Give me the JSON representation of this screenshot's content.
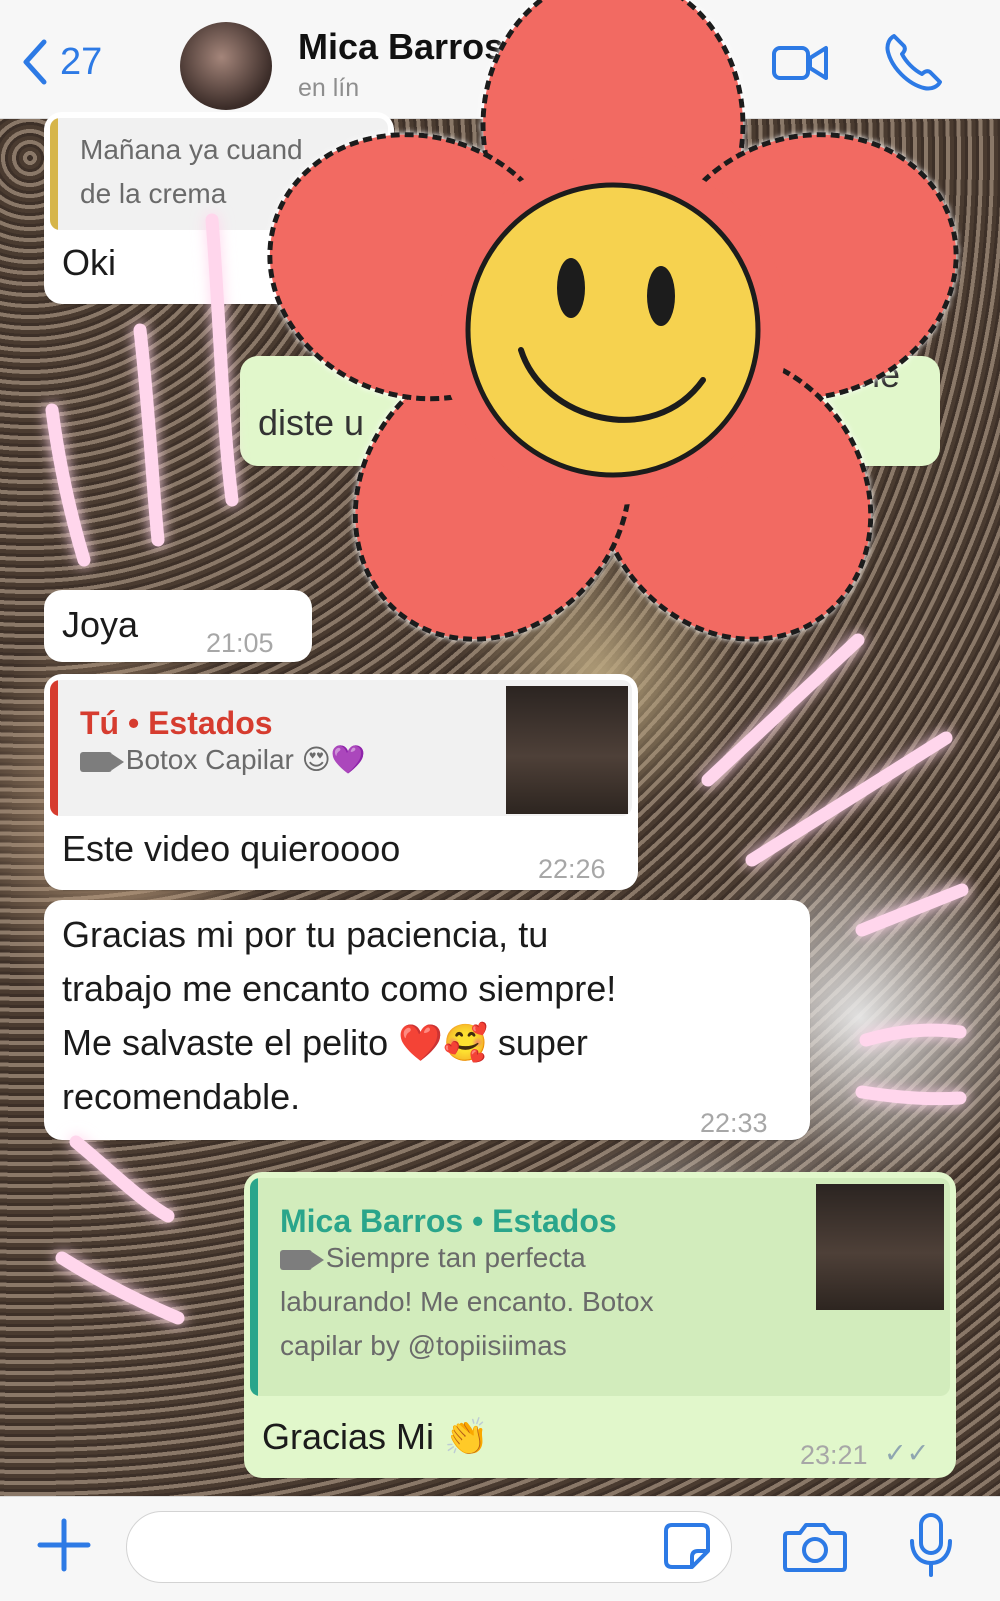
{
  "header": {
    "back_count": "27",
    "contact_name": "Mica Barros",
    "contact_status": "en lín"
  },
  "messages": {
    "m1": {
      "quote_line1": "Mañana ya cuand",
      "quote_line2": "de la crema",
      "text": "Oki"
    },
    "m2": {
      "text_partial": "diste u",
      "text_tail": "ne"
    },
    "m3": {
      "text": "Joya",
      "time": "21:05"
    },
    "m4": {
      "quote_title": "Tú • Estados",
      "quote_text": "Botox Capilar 😍💜",
      "text": "Este video quieroooo",
      "time": "22:26"
    },
    "m5": {
      "line1": "Gracias mi por tu paciencia,  tu",
      "line2": "trabajo me encanto como siempre!",
      "line3": "Me salvaste el pelito ❤️🥰 super",
      "line4": "recomendable.",
      "time": "22:33"
    },
    "m6": {
      "quote_title": "Mica Barros • Estados",
      "quote_line1": "Siempre tan perfecta",
      "quote_line2": "laburando! Me encanto. Botox",
      "quote_line3": "capilar by @topiisiimas",
      "text": "Gracias Mi 👏",
      "time": "23:21",
      "status": "✓✓"
    }
  },
  "icons": {
    "back": "chevron-left-icon",
    "video": "video-call-icon",
    "phone": "phone-icon",
    "plus": "plus-icon",
    "sticker": "sticker-icon",
    "camera": "camera-icon",
    "mic": "microphone-icon"
  },
  "colors": {
    "accent": "#2d7ae5",
    "outgoing_bubble": "#e1f7cb",
    "incoming_bubble": "#ffffff",
    "quote_self": "#d63c2f",
    "quote_contact": "#2aa58b",
    "flower_petals": "#f26a62",
    "flower_face": "#f6d24f"
  }
}
